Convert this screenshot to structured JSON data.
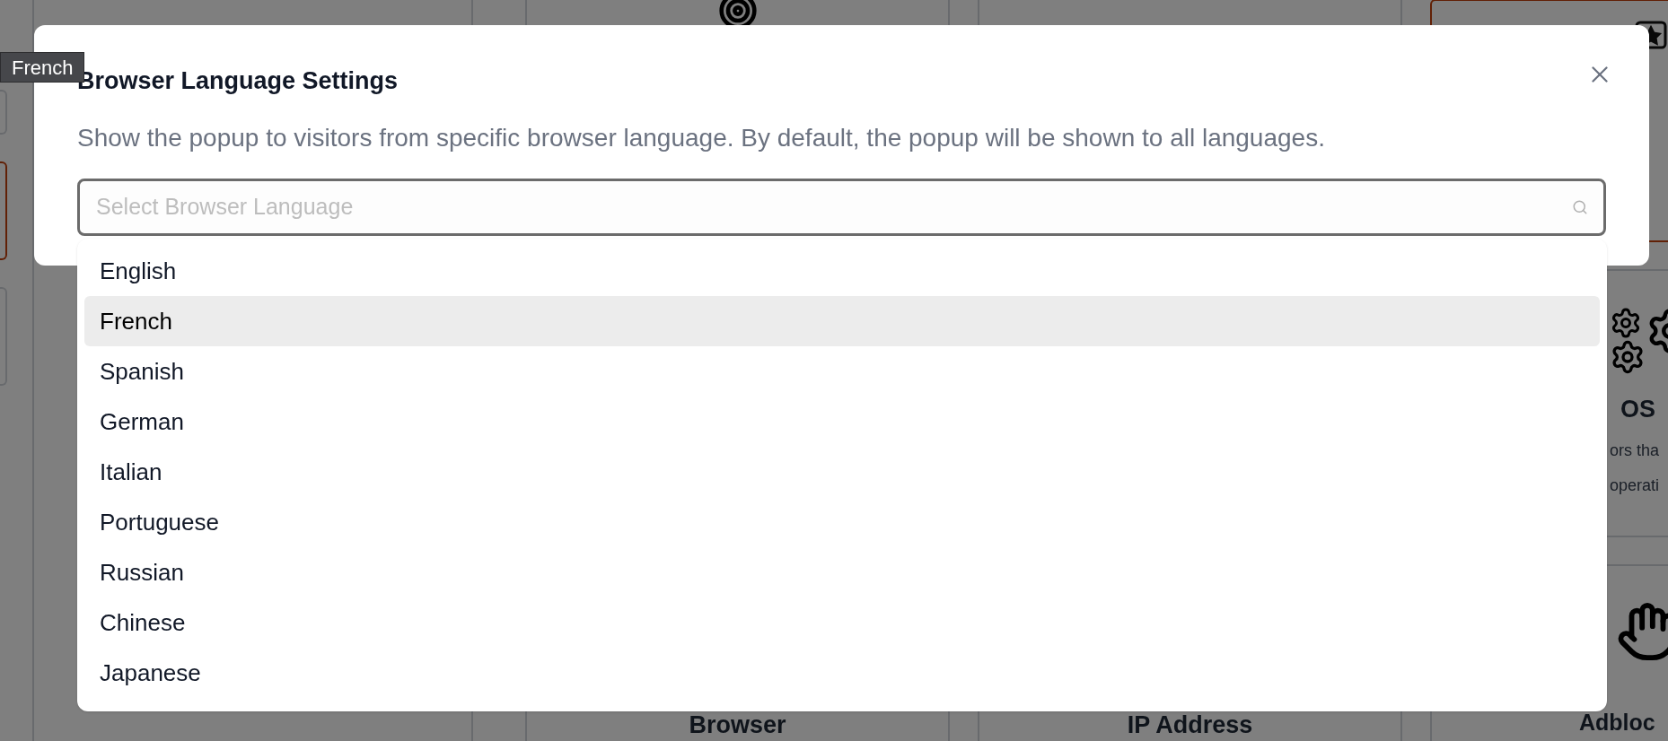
{
  "background": {
    "cards": [
      {
        "title": "Browser"
      },
      {
        "title": "IP Address"
      }
    ],
    "side_cards": [
      {
        "selected": true
      },
      {
        "title": "OS",
        "lines": [
          "ors tha",
          "operati"
        ],
        "selected": false
      },
      {
        "title": "Adbloc",
        "selected": false
      }
    ]
  },
  "dialog": {
    "title": "Browser Language Settings",
    "description": "Show the popup to visitors from specific browser language. By default, the popup will be shown to all languages.",
    "search": {
      "placeholder": "Select Browser Language"
    },
    "options": [
      {
        "label": "English",
        "selected": false
      },
      {
        "label": "French",
        "selected": true
      },
      {
        "label": "Spanish",
        "selected": false
      },
      {
        "label": "German",
        "selected": false
      },
      {
        "label": "Italian",
        "selected": false
      },
      {
        "label": "Portuguese",
        "selected": false
      },
      {
        "label": "Russian",
        "selected": false
      },
      {
        "label": "Chinese",
        "selected": false
      },
      {
        "label": "Japanese",
        "selected": false
      }
    ]
  },
  "tooltip": {
    "text": "French"
  }
}
